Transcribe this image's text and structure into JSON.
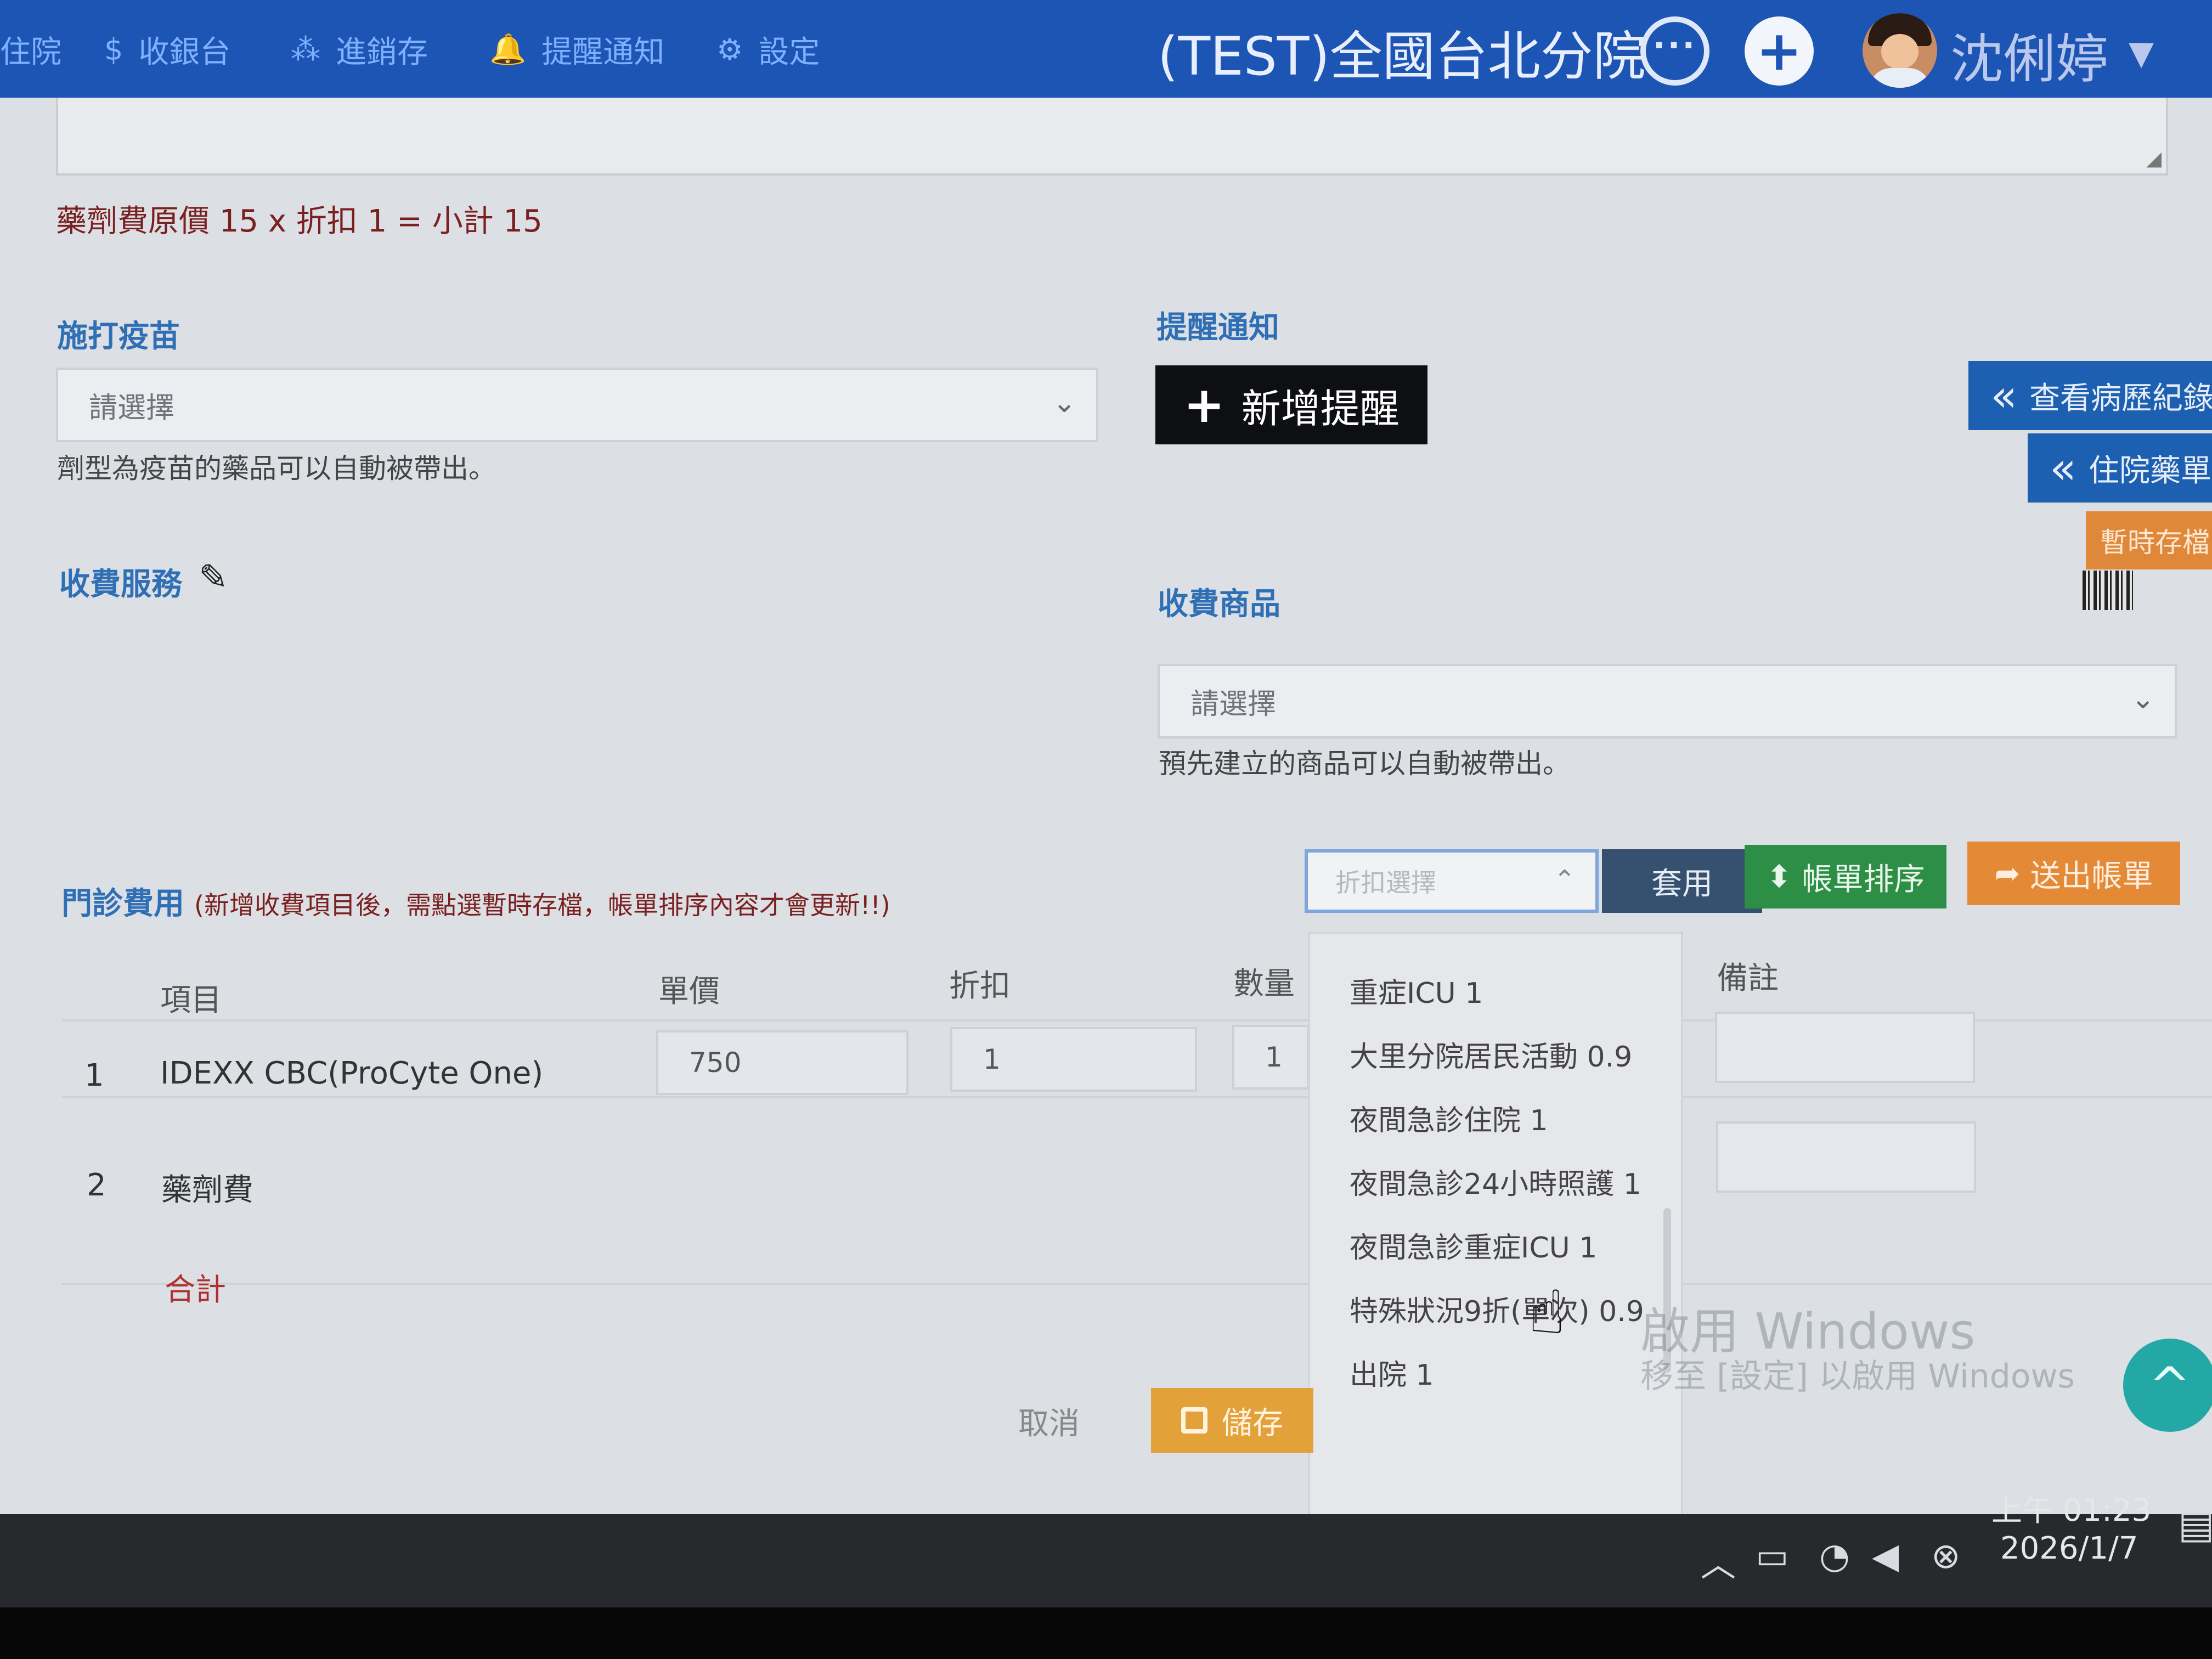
{
  "nav": {
    "items": [
      {
        "label": "住院",
        "icon": ""
      },
      {
        "label": "收銀台",
        "icon": "$"
      },
      {
        "label": "進銷存",
        "icon": "⁂"
      },
      {
        "label": "提醒通知",
        "icon": "🔔"
      },
      {
        "label": "設定",
        "icon": "⚙"
      }
    ],
    "clinic_name": "(TEST)全國台北分院",
    "user_name": "沈俐婷",
    "caret": "▼",
    "chat_glyph": "···",
    "plus_glyph": "+"
  },
  "form": {
    "formula": "藥劑費原價 15 x 折扣 1 = 小計 15",
    "vaccine_label": "施打疫苗",
    "vaccine_placeholder": "請選擇",
    "vaccine_help": "劑型為疫苗的藥品可以自動被帶出。",
    "reminder_label": "提醒通知",
    "add_reminder": "新增提醒",
    "service_label": "收費服務",
    "product_label": "收費商品",
    "product_placeholder": "請選擇",
    "product_help": "預先建立的商品可以自動被帶出。"
  },
  "side": {
    "history": "查看病歷紀錄",
    "inpatient_rx": "住院藥單",
    "temp_save": "暫時存檔"
  },
  "fees": {
    "title": "門診費用",
    "note": "(新增收費項目後，需點選暫時存檔，帳單排序內容才會更新!!)",
    "discount_placeholder": "折扣選擇",
    "apply": "套用",
    "sort": "帳單排序",
    "send": "送出帳單",
    "columns": {
      "item": "項目",
      "price": "單價",
      "discount": "折扣",
      "qty": "數量",
      "remark": "備註"
    },
    "rows": [
      {
        "no": "1",
        "item": "IDEXX CBC(ProCyte One)",
        "price": "750",
        "discount": "1",
        "qty": "1"
      },
      {
        "no": "2",
        "item": "藥劑費"
      }
    ],
    "total": "合計"
  },
  "discount_options": [
    "重症ICU 1",
    "大里分院居民活動 0.9",
    "夜間急診住院 1",
    "夜間急診24小時照護 1",
    "夜間急診重症ICU 1",
    "特殊狀況9折(單次) 0.9",
    "出院 1"
  ],
  "actions": {
    "cancel": "取消",
    "save": "儲存"
  },
  "watermark": {
    "line1": "啟用 Windows",
    "line2": "移至 [設定] 以啟用 Windows"
  },
  "scroll_top_glyph": "^",
  "taskbar": {
    "time": "上午 01:23",
    "date": "2026/1/7"
  }
}
